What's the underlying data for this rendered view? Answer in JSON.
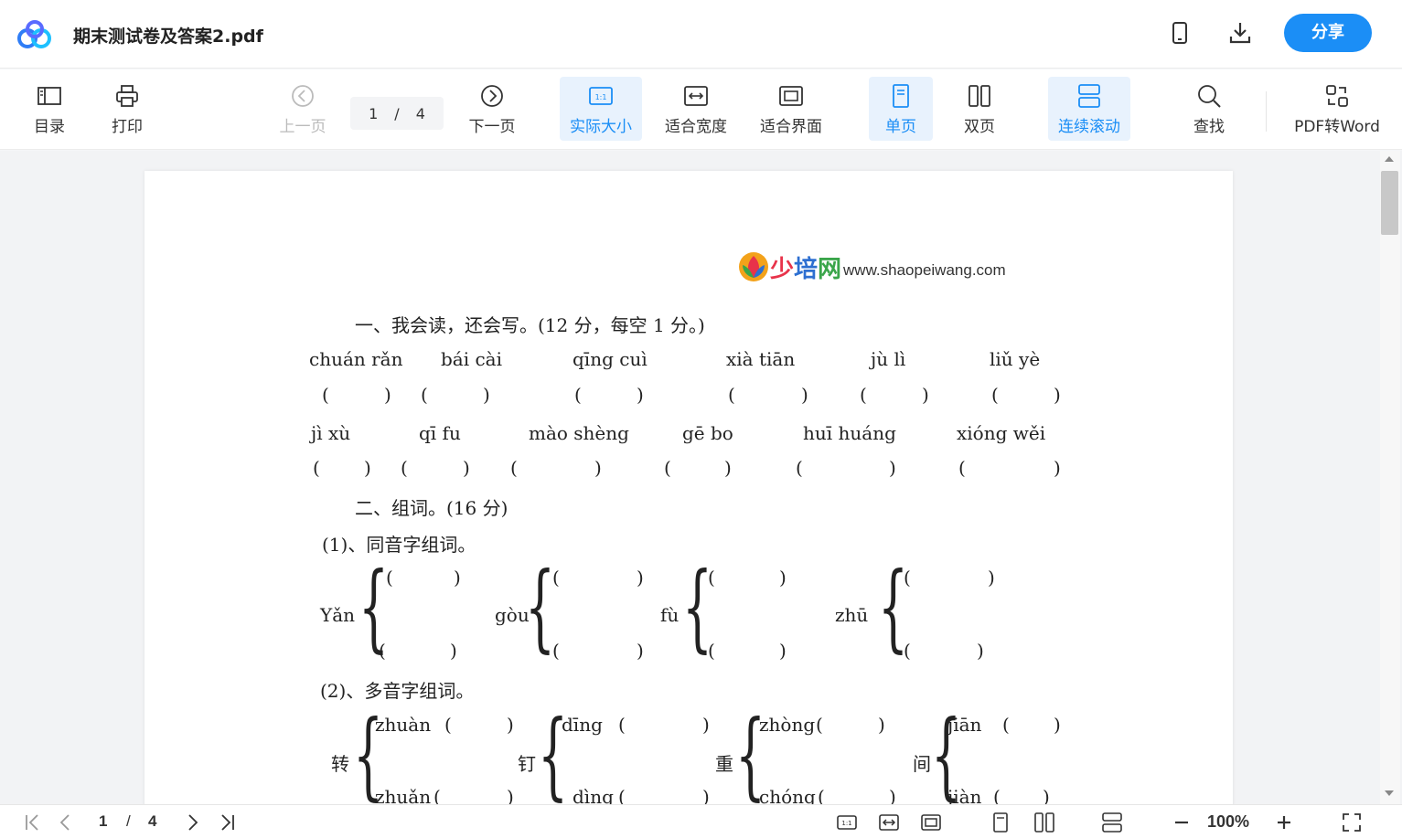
{
  "app": {
    "doc_title": "期末测试卷及答案2.pdf",
    "share_label": "分享"
  },
  "toolbar": {
    "toc": "目录",
    "print": "打印",
    "prev": "上一页",
    "next": "下一页",
    "page_current": "1",
    "page_sep": "/",
    "page_total": "4",
    "actual_size": "实际大小",
    "fit_width": "适合宽度",
    "fit_page": "适合界面",
    "single_page": "单页",
    "double_page": "双页",
    "continuous": "连续滚动",
    "search": "查找",
    "pdf_to_word": "PDF转Word"
  },
  "document": {
    "brand_cn": "少培网",
    "brand_url": "www.shaopeiwang.com",
    "section1": "一、我会读，还会写。(12 分，每空 1 分。)",
    "row1": [
      "chuán rǎn",
      "bái cài",
      "qīng cuì",
      "xià tiān",
      "jù lì",
      "liǔ yè"
    ],
    "row2": [
      "jì xù",
      "qī fu",
      "mào shèng",
      "gē bo",
      "huī huáng",
      "xióng wěi"
    ],
    "paren": "(",
    "paren_close": ")",
    "section2": "二、组词。(16 分)",
    "sub1": "(1)、同音字组词。",
    "homophones": [
      "Yǎn",
      "gòu",
      "fù",
      "zhū"
    ],
    "sub2": "(2)、多音字组词。",
    "polyphones": [
      {
        "char": "转",
        "top": "zhuàn",
        "bottom": "zhuǎn"
      },
      {
        "char": "钉",
        "top": "dīng",
        "bottom": "dìng"
      },
      {
        "char": "重",
        "top": "zhòng",
        "bottom": "chóng"
      },
      {
        "char": "间",
        "top": "jiān",
        "bottom": "jiàn"
      }
    ]
  },
  "bottombar": {
    "page_current": "1",
    "page_sep": "/",
    "page_total": "4",
    "zoom": "100%"
  },
  "colors": {
    "accent": "#1b8ef6",
    "active_bg": "#e8f2fd"
  }
}
